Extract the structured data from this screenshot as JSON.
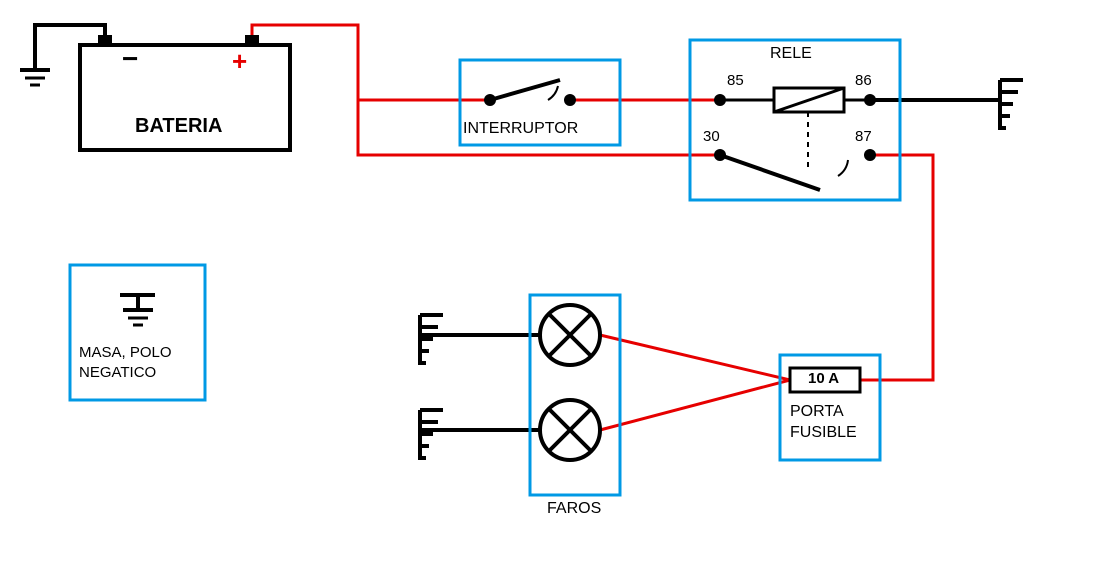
{
  "components": {
    "battery_label": "BATERIA",
    "switch_label": "INTERRUPTOR",
    "relay_label": "RELE",
    "relay_pin_85": "85",
    "relay_pin_86": "86",
    "relay_pin_30": "30",
    "relay_pin_87": "87",
    "ground_legend_label": "MASA, POLO\nNEGATICO",
    "faros_label": "FAROS",
    "fuse_value": "10 A",
    "fuse_label": "PORTA\nFUSIBLE"
  },
  "colors": {
    "blue": "#0099e5",
    "red": "#e60000",
    "black": "#000000"
  },
  "wiring": {
    "positive": "red (from battery +)",
    "negative": "black (chassis ground)"
  }
}
